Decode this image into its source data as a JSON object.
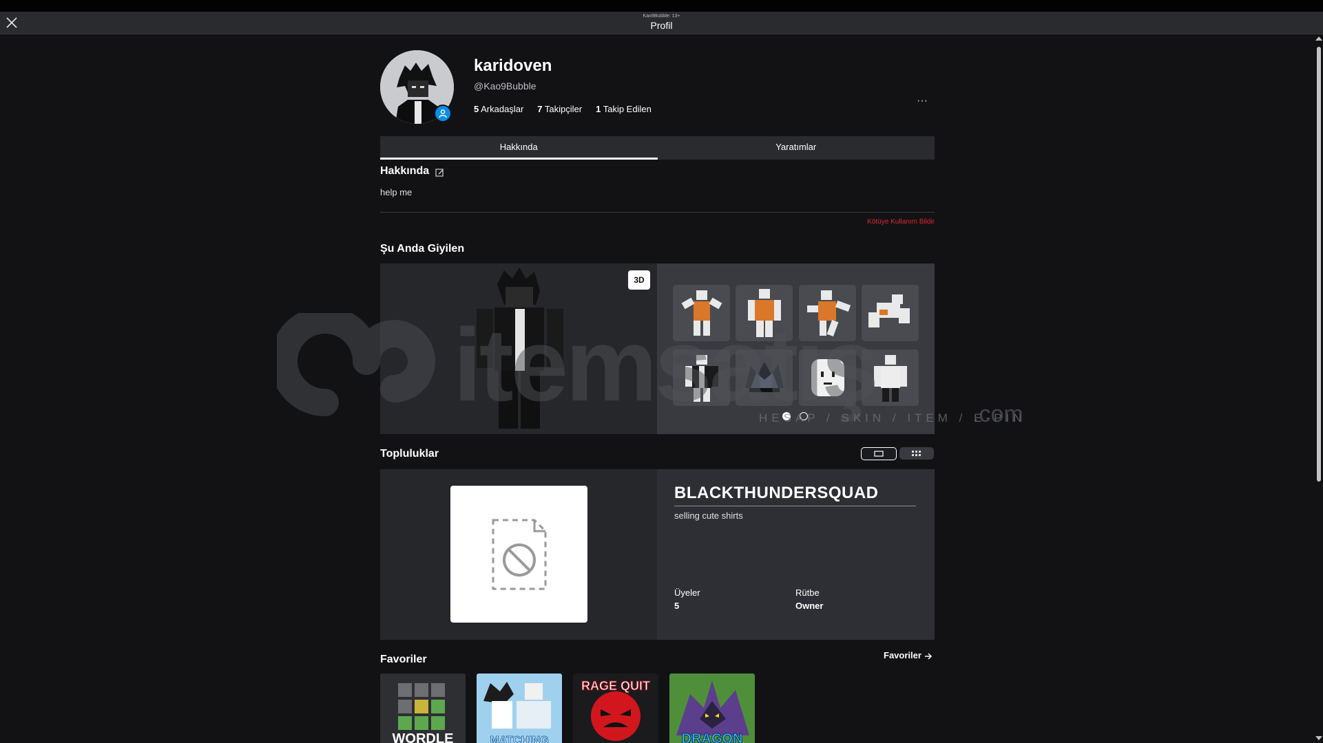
{
  "window": {
    "small_caption": "Kao9Bubble: 13+",
    "title": "Profil"
  },
  "profile": {
    "display_name": "karidoven",
    "handle": "@Kao9Bubble",
    "friends_count": "5",
    "friends_label": "Arkadaşlar",
    "followers_count": "7",
    "followers_label": "Takipçiler",
    "following_count": "1",
    "following_label": "Takip Edilen",
    "more_label": "···"
  },
  "tabs": [
    {
      "label": "Hakkında",
      "active": true
    },
    {
      "label": "Yaratımlar",
      "active": false
    }
  ],
  "about": {
    "title": "Hakkında",
    "text": "help me",
    "report_label": "Kötüye Kullanım Bildir"
  },
  "wearing": {
    "title": "Şu Anda Giyilen",
    "btn_3d": "3D"
  },
  "communities": {
    "title": "Topluluklar",
    "name": "BLACKTHUNDERSQUAD",
    "description": "selling cute shirts",
    "members_label": "Üyeler",
    "members_value": "5",
    "rank_label": "Rütbe",
    "rank_value": "Owner"
  },
  "favorites": {
    "title": "Favoriler",
    "link_label": "Favoriler",
    "games": [
      {
        "title": "WORDLE"
      },
      {
        "title": "MATCHING"
      },
      {
        "title": "RAGE QUIT"
      },
      {
        "title": "DRAGON"
      }
    ]
  },
  "watermark": {
    "brand": "itemsatış",
    "tagline": "HESAP / SKIN / ITEM / E-PIN",
    "tld": ".com"
  },
  "colors": {
    "background": "#121215",
    "panel": "#2a2b2f",
    "report": "#e0262c",
    "status_badge": "#0b8de8"
  }
}
